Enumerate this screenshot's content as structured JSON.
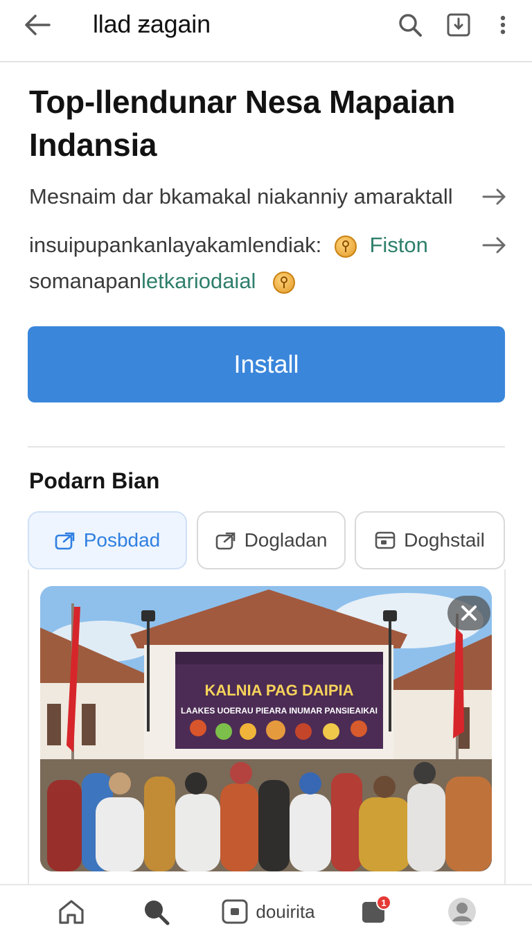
{
  "topbar": {
    "title": "llad ƶagain",
    "icons": [
      "back-arrow-icon",
      "search-icon",
      "download-icon",
      "more-vertical-icon"
    ]
  },
  "app": {
    "title": "Top-llendunar Nesa Mapaian Indansia",
    "desc_line1": "Mesnaim dar bkamakal niakanniy amaraktall",
    "desc_line2_text": "insuipupankanlayakamlendiak:",
    "desc_line2_link": "Fiston",
    "desc_line3_text": "somanapan",
    "desc_line3_link": "letkariodaial",
    "install_label": "Install"
  },
  "section": {
    "title": "Podarn Bian",
    "tabs": [
      {
        "label": "Posbdad",
        "icon": "share-icon",
        "active": true
      },
      {
        "label": "Dogladan",
        "icon": "share-icon",
        "active": false
      },
      {
        "label": "Doghstail",
        "icon": "window-icon",
        "active": false
      }
    ]
  },
  "banner": {
    "line1": "KALNIA PAG DAIPIA",
    "line2": "LAAKES UOERAU PIEARA INUMAR PANSIEAIKAI"
  },
  "bottom_nav": {
    "feed_label": "douirita",
    "inbox_badge": "1"
  },
  "colors": {
    "accent": "#3a86db",
    "link_green": "#2e7f6b",
    "tab_active_text": "#2f7fe1"
  }
}
